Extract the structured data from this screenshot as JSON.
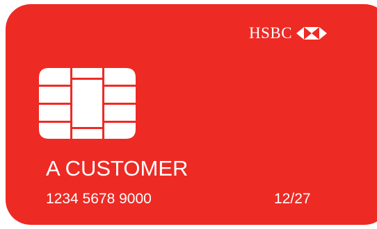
{
  "card": {
    "background_color": "#ee2a24",
    "text_color": "#ffffff",
    "brand": {
      "name": "HSBC",
      "logo_icon": "hexagon-icon"
    },
    "chip_icon": "chip-icon",
    "holder_name": "A CUSTOMER",
    "number": "1234 5678 9000",
    "expiry": "12/27"
  }
}
